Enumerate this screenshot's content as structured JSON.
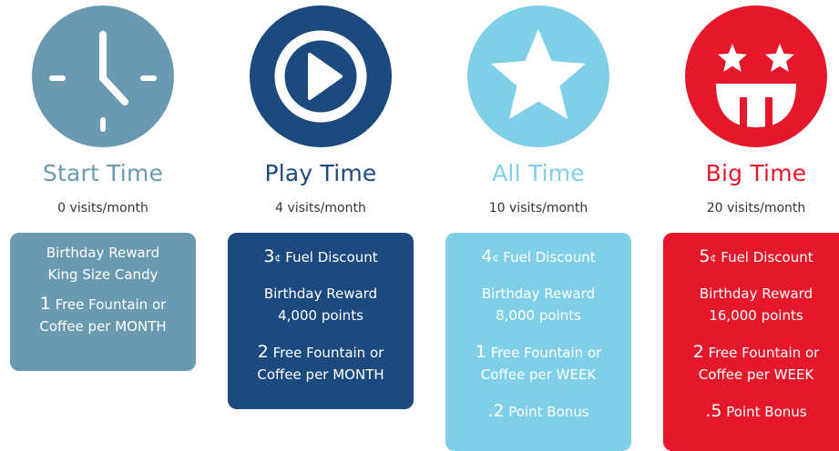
{
  "colors": {
    "start": "#6a9ab0",
    "play": "#1c4a7e",
    "all": "#7fcfe9",
    "big": "#e5182b",
    "visits_text": "#333333"
  },
  "tiers": [
    {
      "name": "Start Time",
      "icon": "clock-icon",
      "visits": "0 visits/month",
      "benefits": [
        {
          "line1": "Birthday Reward",
          "line2": "King Size Candy"
        },
        {
          "num": "1",
          "line1": "Free Fountain or",
          "line2": "Coffee per MONTH"
        }
      ]
    },
    {
      "name": "Play Time",
      "icon": "play-icon",
      "visits": "4 visits/month",
      "benefits": [
        {
          "num": "3",
          "sup": "¢",
          "line1": "Fuel Discount"
        },
        {
          "line1": "Birthday Reward",
          "line2": "4,000 points"
        },
        {
          "num": "2",
          "line1": "Free Fountain or",
          "line2": "Coffee per MONTH"
        }
      ]
    },
    {
      "name": "All Time",
      "icon": "star-icon",
      "visits": "10 visits/month",
      "benefits": [
        {
          "num": "4",
          "sup": "¢",
          "line1": "Fuel Discount"
        },
        {
          "line1": "Birthday Reward",
          "line2": "8,000 points"
        },
        {
          "num": "1",
          "line1": "Free Fountain or",
          "line2": "Coffee per WEEK"
        },
        {
          "num": ".2",
          "line1": "Point Bonus"
        }
      ]
    },
    {
      "name": "Big Time",
      "icon": "starstruck-face-icon",
      "visits": "20 visits/month",
      "benefits": [
        {
          "num": "5",
          "sup": "¢",
          "line1": "Fuel Discount"
        },
        {
          "line1": "Birthday Reward",
          "line2": "16,000 points"
        },
        {
          "num": "2",
          "line1": "Free Fountain or",
          "line2": "Coffee per WEEK"
        },
        {
          "num": ".5",
          "line1": "Point Bonus"
        }
      ]
    }
  ]
}
